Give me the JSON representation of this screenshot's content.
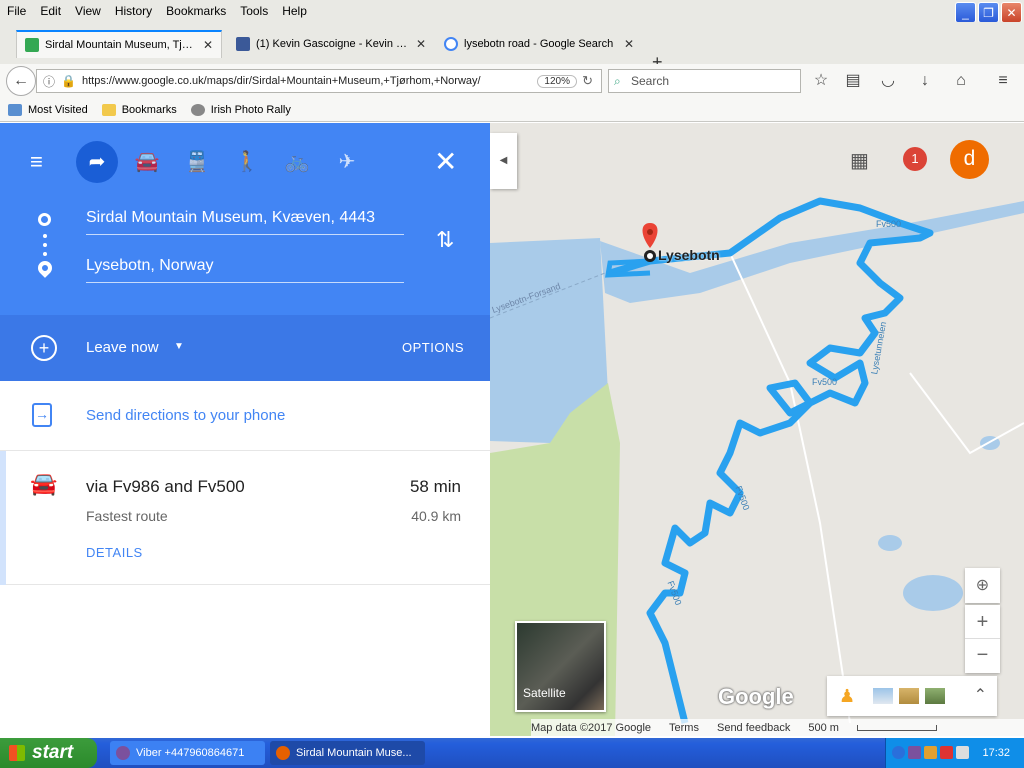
{
  "menubar": {
    "items": [
      "File",
      "Edit",
      "View",
      "History",
      "Bookmarks",
      "Tools",
      "Help"
    ]
  },
  "tabs": [
    {
      "title": "Sirdal Mountain Museum, Tjør...",
      "active": true
    },
    {
      "title": "(1) Kevin Gascoigne - Kevin G...",
      "active": false
    },
    {
      "title": "lysebotn road - Google Search",
      "active": false
    }
  ],
  "navbar": {
    "url": "https://www.google.co.uk/maps/dir/Sirdal+Mountain+Museum,+Tjørhom,+Norway/",
    "zoom": "120%",
    "search_placeholder": "Search"
  },
  "bookmarks": [
    "Most Visited",
    "Bookmarks",
    "Irish Photo Rally"
  ],
  "directions": {
    "origin": "Sirdal Mountain Museum, Kvæven, 4443",
    "destination": "Lysebotn, Norway",
    "leave_now": "Leave now",
    "options": "OPTIONS",
    "send_to_phone": "Send directions to your phone",
    "route": {
      "via": "via Fv986 and Fv500",
      "duration": "58 min",
      "note": "Fastest route",
      "distance": "40.9 km",
      "details": "DETAILS"
    }
  },
  "map": {
    "place_label": "Lysebotn",
    "road_labels": [
      "Fv500",
      "Fv500",
      "Fv500",
      "Fv500",
      "Lysetunnelen",
      "Lysebotn-Forsand"
    ],
    "notification_count": "1",
    "avatar_letter": "d",
    "satellite_label": "Satellite",
    "logo": "Google",
    "attribution": [
      "Map data ©2017 Google",
      "Terms",
      "Send feedback",
      "500 m"
    ],
    "route_color": "#29a1ef",
    "water_color": "#a9cbe9"
  },
  "taskbar": {
    "start": "start",
    "tasks": [
      "Viber +447960864671",
      "Sirdal Mountain Muse..."
    ],
    "clock": "17:32"
  }
}
